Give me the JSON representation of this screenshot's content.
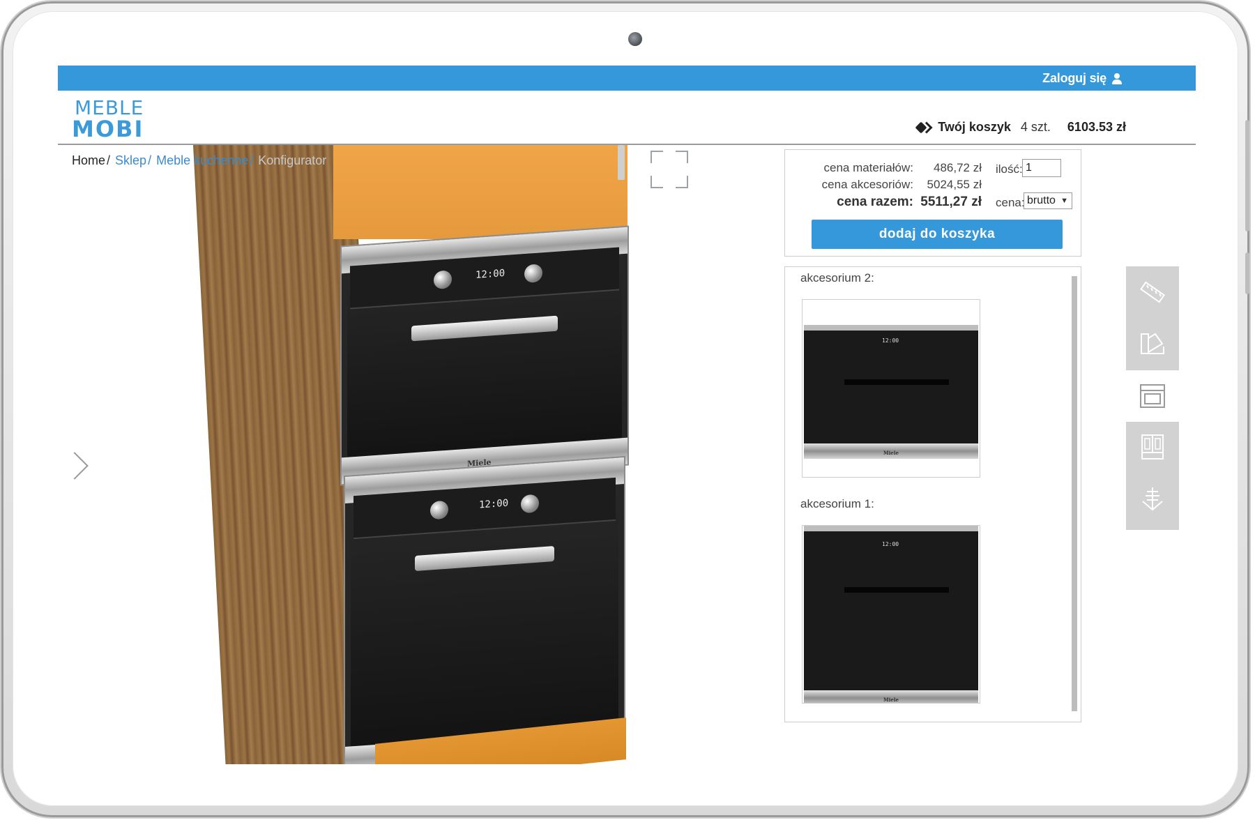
{
  "header": {
    "login_label": "Zaloguj się",
    "logo_top": "MEBLE",
    "logo_bottom": "MOBI",
    "cart_title": "Twój koszyk",
    "cart_count": "4 szt.",
    "cart_total": "6103.53 zł"
  },
  "breadcrumb": {
    "home": "Home",
    "sklep": "Sklep",
    "category": "Meble kuchenne",
    "current": "Konfigurator"
  },
  "preview": {
    "clock_top": "12:00",
    "clock_bottom": "12:00",
    "brand": "Miele"
  },
  "pricing": {
    "materials_label": "cena materiałów:",
    "materials_value": "486,72 zł",
    "accessories_label": "cena akcesoriów:",
    "accessories_value": "5024,55 zł",
    "total_label": "cena razem:",
    "total_value": "5511,27 zł",
    "quantity_label": "ilość:",
    "quantity_value": "1",
    "price_type_label": "cena:",
    "price_type_value": "brutto",
    "add_to_cart_label": "dodaj do koszyka"
  },
  "accessories": [
    {
      "label": "akcesorium 2:",
      "clock": "12:00",
      "brand": "Miele"
    },
    {
      "label": "akcesorium 1:",
      "clock": "12:00",
      "brand": "Miele"
    }
  ],
  "tools": [
    {
      "icon": "ruler-icon"
    },
    {
      "icon": "color-palette-icon"
    },
    {
      "icon": "oven-icon"
    },
    {
      "icon": "cabinet-fronts-icon"
    },
    {
      "icon": "handle-icon"
    }
  ],
  "colors": {
    "accent": "#3598db",
    "link": "#3a8ad0",
    "tool_bg": "#d2d2d2"
  }
}
